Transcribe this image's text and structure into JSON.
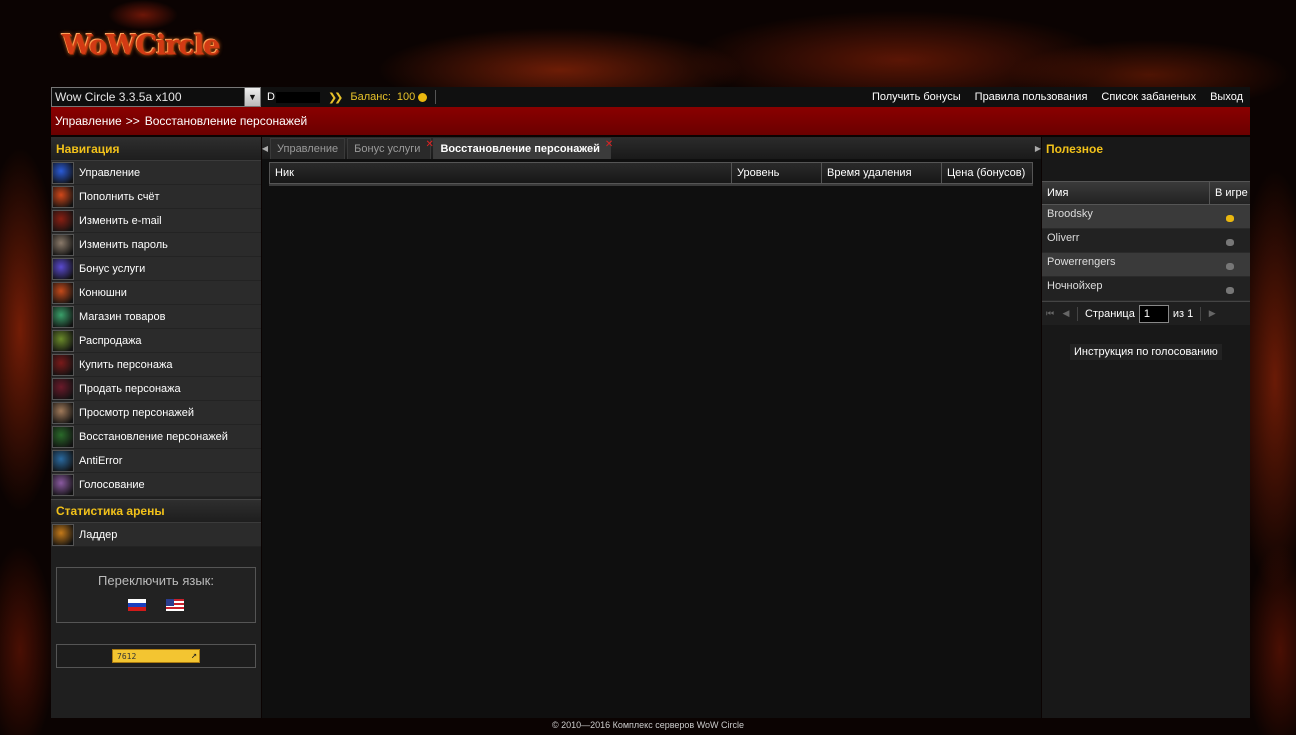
{
  "logo": {
    "text": "WoWCircle"
  },
  "topbar": {
    "realm": "Wow Circle 3.3.5a x100",
    "user_initial": "D",
    "balance_label": "Баланс:",
    "balance_value": "100",
    "links": [
      "Получить бонусы",
      "Правила пользования",
      "Список забаненых",
      "Выход"
    ]
  },
  "breadcrumb": {
    "root": "Управление",
    "sep": ">>",
    "current": "Восстановление персонажей"
  },
  "nav": {
    "title": "Навигация",
    "items": [
      {
        "label": "Управление",
        "icon": "swirl-icon",
        "color": "#2a5bd8"
      },
      {
        "label": "Пополнить счёт",
        "icon": "fire-icon",
        "color": "#d2481a"
      },
      {
        "label": "Изменить e-mail",
        "icon": "flame-icon",
        "color": "#8a1f12"
      },
      {
        "label": "Изменить пароль",
        "icon": "face-icon",
        "color": "#8a7a6a"
      },
      {
        "label": "Бонус услуги",
        "icon": "sword-icon",
        "color": "#5a4ad0"
      },
      {
        "label": "Конюшни",
        "icon": "horse-icon",
        "color": "#c44a1a"
      },
      {
        "label": "Магазин товаров",
        "icon": "orb-icon",
        "color": "#3aa06a"
      },
      {
        "label": "Распродажа",
        "icon": "tree-icon",
        "color": "#6a8a2a"
      },
      {
        "label": "Купить персонажа",
        "icon": "demon-icon",
        "color": "#7a1a1a"
      },
      {
        "label": "Продать персонажа",
        "icon": "demon2-icon",
        "color": "#6a1a2a"
      },
      {
        "label": "Просмотр персонажей",
        "icon": "dwarf-icon",
        "color": "#a07a5a"
      },
      {
        "label": "Восстановление персонажей",
        "icon": "rune-icon",
        "color": "#2a6a2a"
      },
      {
        "label": "AntiError",
        "icon": "vortex-icon",
        "color": "#2a6aa0"
      },
      {
        "label": "Голосование",
        "icon": "cross-icon",
        "color": "#8a5aa0"
      }
    ],
    "arena_title": "Статистика арены",
    "arena_items": [
      {
        "label": "Ладдер",
        "icon": "trophy-icon",
        "color": "#c47a1a"
      }
    ]
  },
  "language": {
    "title": "Переключить язык:",
    "flags": [
      "flag-ru-icon",
      "flag-us-icon"
    ]
  },
  "counter": {
    "text": "7612"
  },
  "tabs": [
    {
      "label": "Управление",
      "closable": false,
      "active": false
    },
    {
      "label": "Бонус услуги",
      "closable": true,
      "active": false
    },
    {
      "label": "Восстановление персонажей",
      "closable": true,
      "active": true
    }
  ],
  "grid": {
    "columns": [
      "Ник",
      "Уровень",
      "Время удаления",
      "Цена (бонусов)"
    ]
  },
  "useful": {
    "title": "Полезное",
    "columns": [
      "Имя",
      "В игре"
    ],
    "rows": [
      {
        "name": "Broodsky",
        "online": true
      },
      {
        "name": "Oliverr",
        "online": false
      },
      {
        "name": "Powerrengers",
        "online": false
      },
      {
        "name": "Ночнойхер",
        "online": false
      }
    ],
    "pager": {
      "page_label": "Страница",
      "page": "1",
      "of_label": "из 1"
    },
    "vote_button": "Инструкция по голосованию"
  },
  "colors": {
    "accent": "#f2c21a",
    "breadcrumb_red": "#7a0000",
    "online": "#e9b70f",
    "offline": "#777777"
  },
  "footer": "© 2010—2016 Комплекс серверов WoW Circle"
}
